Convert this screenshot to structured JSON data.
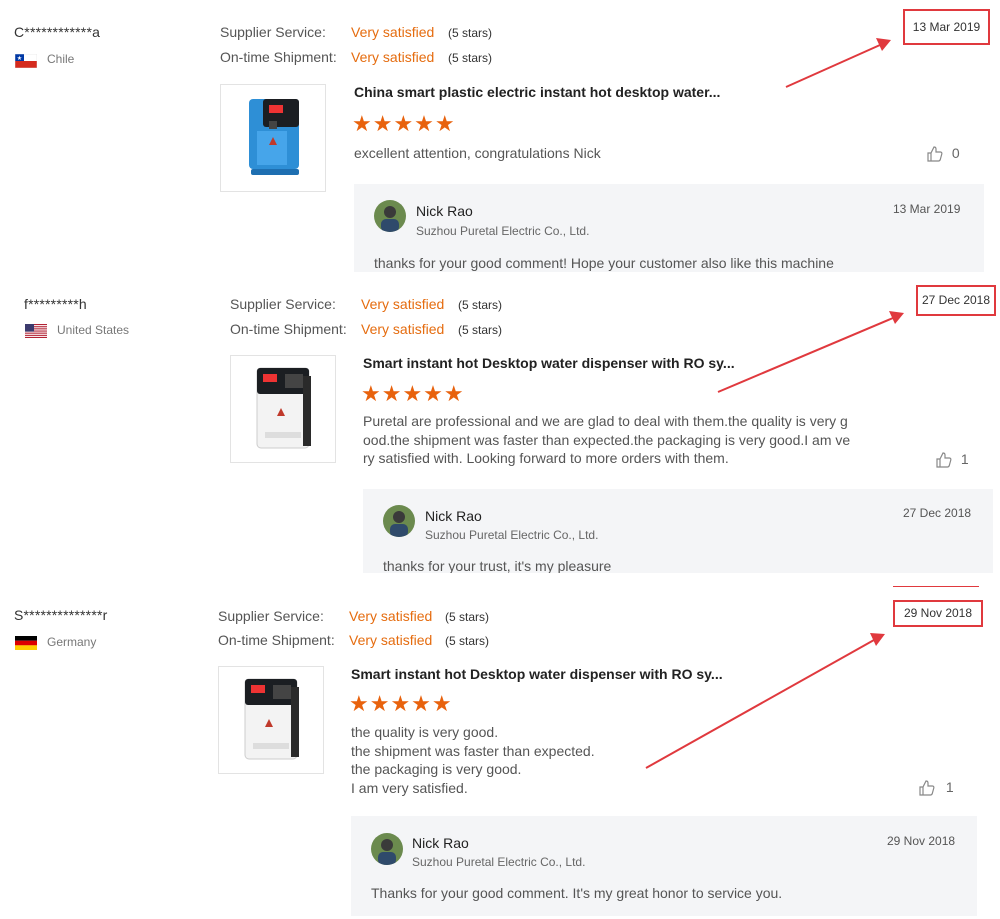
{
  "labels": {
    "supplier_service": "Supplier Service:",
    "on_time_shipment": "On-time Shipment:"
  },
  "reviews": [
    {
      "buyer": "C************a",
      "country": "Chile",
      "flag": "chile-flag",
      "supplier_rating": "Very satisfied",
      "supplier_stars": "(5 stars)",
      "shipment_rating": "Very satisfied",
      "shipment_stars": "(5 stars)",
      "date": "13 Mar 2019",
      "product": "China smart plastic electric instant hot desktop water...",
      "product_image": "blue-water-dispenser-icon",
      "stars": "★★★★★",
      "comment": [
        "excellent attention, congratulations Nick"
      ],
      "likes": "0",
      "reply": {
        "name": "Nick Rao",
        "company": "Suzhou Puretal Electric Co., Ltd.",
        "date": "13 Mar 2019",
        "text": "thanks for your good comment!  Hope your customer also like this machine"
      }
    },
    {
      "buyer": "f*********h",
      "country": "United States",
      "flag": "us-flag",
      "supplier_rating": "Very satisfied",
      "supplier_stars": "(5 stars)",
      "shipment_rating": "Very satisfied",
      "shipment_stars": "(5 stars)",
      "date": "27 Dec 2018",
      "product": "Smart instant hot Desktop water dispenser with RO sy...",
      "product_image": "white-water-dispenser-icon",
      "stars": "★★★★★",
      "comment": [
        "Puretal are professional and we are glad to deal with them.the quality is very g",
        "ood.the shipment was faster than expected.the packaging is very good.I am ve",
        "ry satisfied with. Looking forward to more orders with them."
      ],
      "likes": "1",
      "reply": {
        "name": "Nick Rao",
        "company": "Suzhou Puretal Electric Co., Ltd.",
        "date": "27 Dec 2018",
        "text": "thanks for your trust, it's my pleasure"
      }
    },
    {
      "buyer": "S**************r",
      "country": "Germany",
      "flag": "germany-flag",
      "supplier_rating": "Very satisfied",
      "supplier_stars": "(5 stars)",
      "shipment_rating": "Very satisfied",
      "shipment_stars": "(5 stars)",
      "date": "29 Nov 2018",
      "product": "Smart instant hot Desktop water dispenser with RO sy...",
      "product_image": "white-water-dispenser-icon",
      "stars": "★★★★★",
      "comment": [
        "the quality is very good.",
        "the shipment was faster than expected.",
        "the packaging is very good.",
        "I am very satisfied."
      ],
      "likes": "1",
      "reply": {
        "name": "Nick Rao",
        "company": "Suzhou Puretal Electric Co., Ltd.",
        "date": "29 Nov 2018",
        "text": "Thanks for your good comment. It's my great honor to service you."
      }
    }
  ],
  "colors": {
    "accent_orange": "#e56c0f",
    "star_orange": "#e8620d",
    "annotation_red": "#e0393e",
    "reply_bg": "#f4f5f7"
  }
}
